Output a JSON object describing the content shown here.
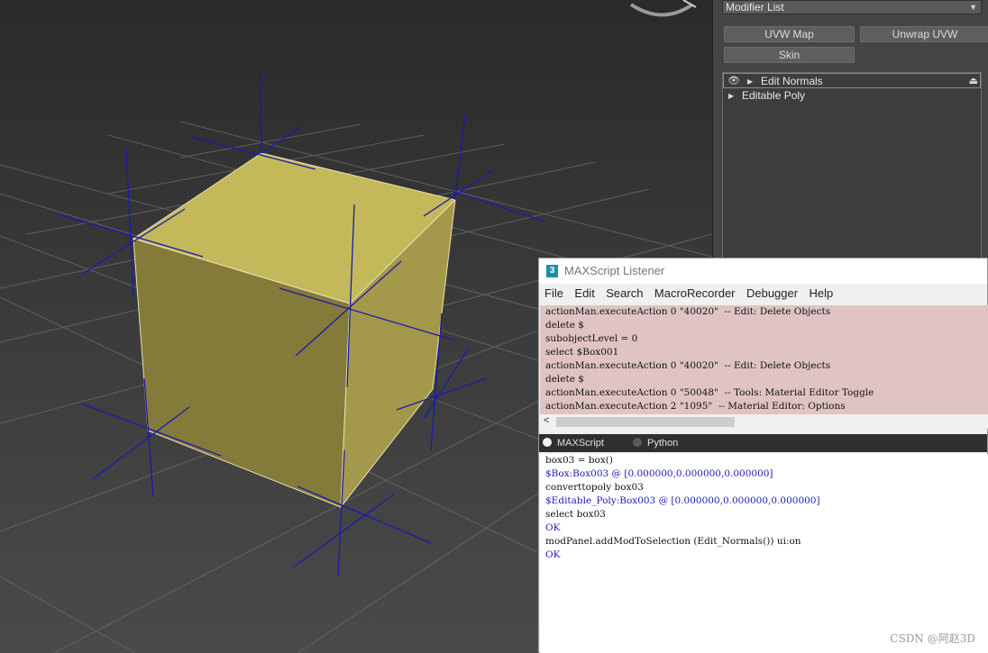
{
  "modifier_panel": {
    "modifier_list_label": "Modifier List",
    "buttons": [
      {
        "label": "UVW Map"
      },
      {
        "label": "Unwrap UVW"
      },
      {
        "label": "Skin"
      }
    ],
    "stack": [
      {
        "label": "Edit Normals",
        "selected": true
      },
      {
        "label": "Editable Poly",
        "selected": false
      }
    ]
  },
  "listener": {
    "title": "MAXScript Listener",
    "menu": [
      "File",
      "Edit",
      "Search",
      "MacroRecorder",
      "Debugger",
      "Help"
    ],
    "macro_lines": [
      "actionMan.executeAction 0 \"40020\"  -- Edit: Delete Objects",
      "delete $",
      "subobjectLevel = 0",
      "select $Box001",
      "actionMan.executeAction 0 \"40020\"  -- Edit: Delete Objects",
      "delete $",
      "actionMan.executeAction 0 \"50048\"  -- Tools: Material Editor Toggle",
      "actionMan.executeAction 2 \"1095\"  -- Material Editor: Options"
    ],
    "modes": [
      {
        "label": "MAXScript",
        "selected": true
      },
      {
        "label": "Python",
        "selected": false
      }
    ],
    "output_lines": [
      {
        "text": "box03 = box()",
        "kind": "input"
      },
      {
        "text": "$Box:Box003 @ [0.000000,0.000000,0.000000]",
        "kind": "result"
      },
      {
        "text": "converttopoly box03",
        "kind": "input"
      },
      {
        "text": "$Editable_Poly:Box003 @ [0.000000,0.000000,0.000000]",
        "kind": "result"
      },
      {
        "text": "select box03",
        "kind": "input"
      },
      {
        "text": "OK",
        "kind": "result"
      },
      {
        "text": "modPanel.addModToSelection (Edit_Normals()) ui:on",
        "kind": "input"
      },
      {
        "text": "OK",
        "kind": "result"
      }
    ]
  },
  "watermark": "CSDN @阿赵3D",
  "colors": {
    "cube_top": "#c4b95a",
    "cube_left": "#847a3a",
    "cube_right": "#a4984a",
    "normals": "#1a1ab0",
    "grid": "#6a6a6a",
    "macro_bg": "#e0c4c4",
    "result_text": "#1a1ab8"
  }
}
